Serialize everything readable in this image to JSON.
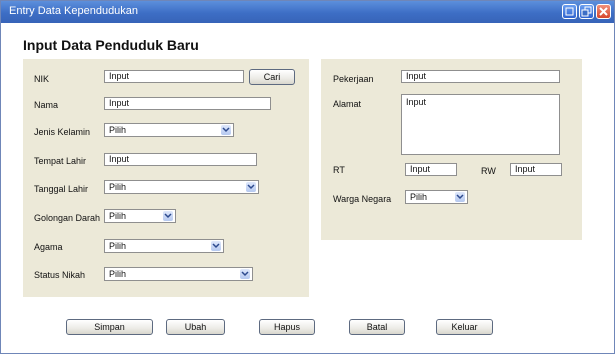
{
  "window": {
    "title": "Entry Data Kependudukan"
  },
  "title_buttons": {
    "minimize_icon": "minimize-icon",
    "maximize_icon": "maximize-icon",
    "close_icon": "close-icon"
  },
  "heading": "Input Data Penduduk Baru",
  "left": {
    "nik": {
      "label": "NIK",
      "value": "Input",
      "button": "Cari"
    },
    "nama": {
      "label": "Nama",
      "value": "Input"
    },
    "jenis_kelamin": {
      "label": "Jenis Kelamin",
      "value": "Pilih"
    },
    "tempat_lahir": {
      "label": "Tempat Lahir",
      "value": "Input"
    },
    "tanggal_lahir": {
      "label": "Tanggal Lahir",
      "value": "Pilih"
    },
    "golongan_darah": {
      "label": "Golongan Darah",
      "value": "Pilih"
    },
    "agama": {
      "label": "Agama",
      "value": "Pilih"
    },
    "status_nikah": {
      "label": "Status Nikah",
      "value": "Pilih"
    }
  },
  "right": {
    "pekerjaan": {
      "label": "Pekerjaan",
      "value": "Input"
    },
    "alamat": {
      "label": "Alamat",
      "value": "Input"
    },
    "rt": {
      "label": "RT",
      "value": "Input"
    },
    "rw": {
      "label": "RW",
      "value": "Input"
    },
    "warga_negara": {
      "label": "Warga Negara",
      "value": "Pilih"
    }
  },
  "actions": {
    "simpan": "Simpan",
    "ubah": "Ubah",
    "hapus": "Hapus",
    "batal": "Batal",
    "keluar": "Keluar"
  },
  "colors": {
    "titlebar": "#3d6ec5",
    "panel": "#ece9d8",
    "close": "#d6462c"
  }
}
